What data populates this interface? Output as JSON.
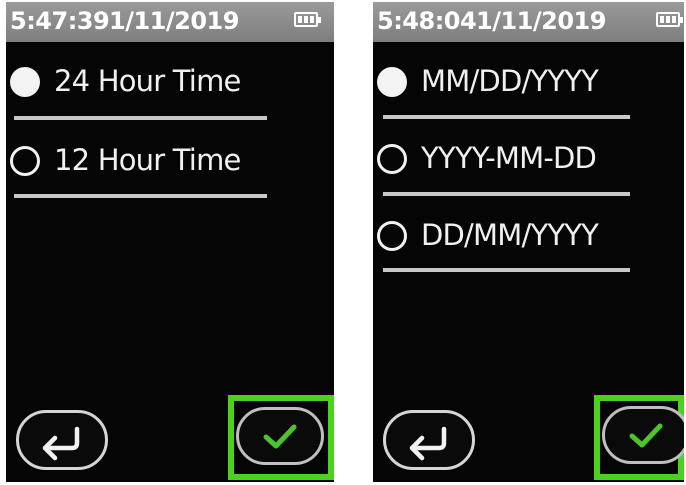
{
  "left_screen": {
    "status_bar": {
      "time": "5:47:39",
      "date": "1/11/2019",
      "battery_icon": "battery-full-icon"
    },
    "options": [
      {
        "label": "24 Hour Time",
        "selected": true
      },
      {
        "label": "12 Hour Time",
        "selected": false
      }
    ],
    "back_icon": "return-arrow-icon",
    "confirm_icon": "checkmark-icon"
  },
  "right_screen": {
    "status_bar": {
      "time": "5:48:04",
      "date": "1/11/2019",
      "battery_icon": "battery-full-icon"
    },
    "options": [
      {
        "label": "MM/DD/YYYY",
        "selected": true
      },
      {
        "label": "YYYY-MM-DD",
        "selected": false
      },
      {
        "label": "DD/MM/YYYY",
        "selected": false
      }
    ],
    "back_icon": "return-arrow-icon",
    "confirm_icon": "checkmark-icon"
  },
  "colors": {
    "screen_background": "#050505",
    "status_bar": "#8a8a8a",
    "highlight": "#4ad21f",
    "checkmark": "#4cc52a",
    "text": "#f0f0f0"
  }
}
